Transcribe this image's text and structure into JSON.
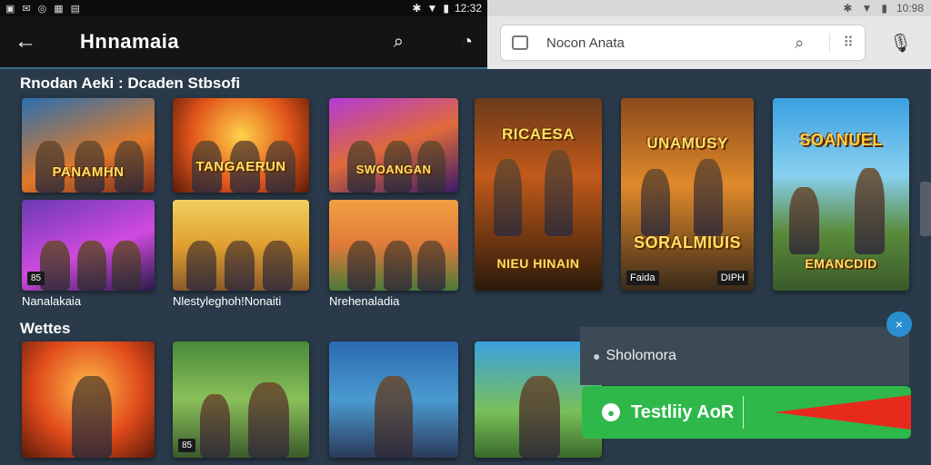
{
  "status_left": {
    "time": "12:32"
  },
  "status_right": {
    "time": "10:98"
  },
  "appbar": {
    "back_icon": "back-arrow-icon",
    "title": "Hnnamaia",
    "search_icon": "search-icon",
    "history_icon": "clock-icon"
  },
  "search": {
    "value": "Nocon Anata",
    "grid_icon": "apps-grid-icon",
    "mic_icon": "mic-icon"
  },
  "sections": {
    "first": "Rnodan Aeki : Dcaden Stbsofi",
    "second": "Wettes"
  },
  "cards": [
    {
      "banner": "PANAMHN",
      "sub": "",
      "badge": ""
    },
    {
      "banner": "TANGAERUN",
      "sub": "",
      "badge": ""
    },
    {
      "banner": "SWOANGAN",
      "sub": "",
      "badge": ""
    },
    {
      "banner": "RICAESA",
      "sub": "NIEU HINAIN",
      "badge": ""
    },
    {
      "banner": "UNAMUSY",
      "sub": "SORALMIUIS",
      "badge": "Faida",
      "badge2": "DIPH"
    },
    {
      "banner": "SOANUEL",
      "sub": "EMANCDID",
      "badge": ""
    },
    {
      "banner": "",
      "sub": "",
      "badge": "85"
    },
    {
      "banner": "",
      "sub": "",
      "badge": ""
    },
    {
      "banner": "",
      "sub": "",
      "badge": ""
    },
    {
      "banner": "",
      "sub": "",
      "badge": "85"
    },
    {
      "banner": "",
      "sub": "",
      "badge": ""
    },
    {
      "banner": "",
      "sub": "",
      "badge": ""
    },
    {
      "banner": "",
      "sub": "",
      "badge": ""
    }
  ],
  "captions": {
    "c1": "Nanalakaia",
    "c2": "Nlestyleghoh!Nonaiti",
    "c3": "Nrehenaladia"
  },
  "overlay": {
    "text": "Sholomora"
  },
  "cta": {
    "label": "Testliiy AoR"
  },
  "close": {
    "label": "×"
  }
}
